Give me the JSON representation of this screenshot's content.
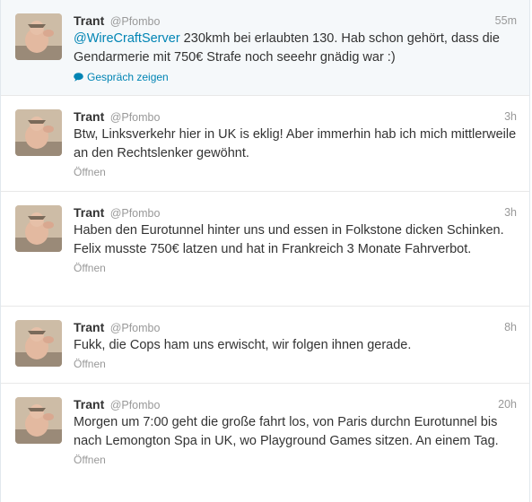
{
  "tweets": [
    {
      "name": "Trant",
      "handle": "@Pfombo",
      "time": "55m",
      "mention": "@WireCraftServer",
      "text": " 230kmh bei erlaubten 130. Hab schon gehört, dass die Gendarmerie mit 750€ Strafe noch seeehr gnädig war :)",
      "action": "Gespräch zeigen",
      "action_icon": "speech-bubble-icon"
    },
    {
      "name": "Trant",
      "handle": "@Pfombo",
      "time": "3h",
      "text": "Btw, Linksverkehr hier in UK is eklig! Aber immerhin hab ich mich mittlerweile an den Rechtslenker gewöhnt.",
      "action": "Öffnen"
    },
    {
      "name": "Trant",
      "handle": "@Pfombo",
      "time": "3h",
      "text": "Haben den Eurotunnel hinter uns und essen in Folkstone dicken Schinken. Felix musste 750€ latzen und hat in Frankreich 3 Monate Fahrverbot.",
      "action": "Öffnen"
    },
    {
      "name": "Trant",
      "handle": "@Pfombo",
      "time": "8h",
      "text": "Fukk, die Cops ham uns erwischt, wir folgen ihnen gerade.",
      "action": "Öffnen"
    },
    {
      "name": "Trant",
      "handle": "@Pfombo",
      "time": "20h",
      "text": "Morgen um 7:00 geht die große fahrt los, von Paris durchn Eurotunnel bis nach Lemongton Spa in UK, wo Playground Games sitzen. An einem Tag.",
      "action": "Öffnen"
    }
  ],
  "colors": {
    "link": "#0084b4",
    "muted": "#999999",
    "text": "#333333",
    "highlight_bg": "#f5f8fa"
  }
}
